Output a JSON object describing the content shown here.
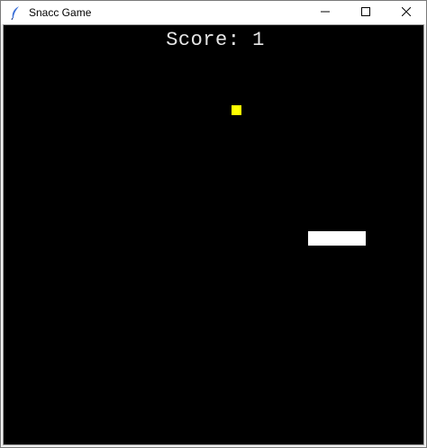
{
  "window": {
    "title": "Snacc Game",
    "icon": "feather-icon",
    "controls": [
      "minimize-icon",
      "maximize-icon",
      "close-icon"
    ]
  },
  "game": {
    "score_text": "Score: 1",
    "score_value": 1,
    "colors": {
      "background": "#000000",
      "snake": "#ffffff",
      "food": "#ffff00",
      "score_text": "#e6e6e6"
    }
  }
}
